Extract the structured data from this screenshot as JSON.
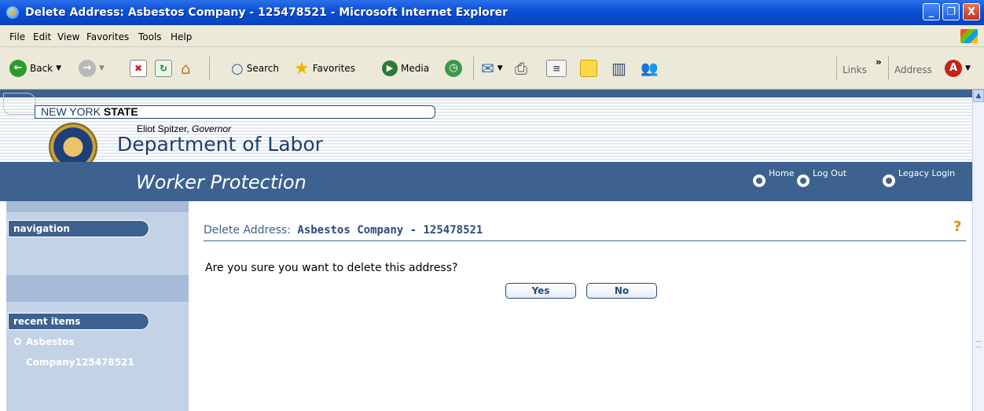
{
  "window": {
    "title": "Delete Address: Asbestos Company - 125478521 - Microsoft Internet Explorer",
    "minimize": "_",
    "restore": "❐",
    "close": "X"
  },
  "menu": [
    "File",
    "Edit",
    "View",
    "Favorites",
    "Tools",
    "Help"
  ],
  "toolbar": {
    "back": "Back",
    "search": "Search",
    "favorites": "Favorites",
    "media": "Media",
    "links": "Links",
    "chevron": "»",
    "address": "Address"
  },
  "header": {
    "new_york": "NEW YORK",
    "state": "STATE",
    "governor_name": "Eliot Spitzer,",
    "governor_title": "Governor",
    "department": "Department of Labor",
    "section": "Worker Protection",
    "links": {
      "home": "Home",
      "logout": "Log Out",
      "legacy": "Legacy Login"
    }
  },
  "sidebar": {
    "navigation": "navigation",
    "recent_items": "recent items",
    "recent": [
      "Asbestos",
      "Company125478521"
    ]
  },
  "content": {
    "title_label": "Delete Address:",
    "title_value": "Asbestos Company - 125478521",
    "message": "Are you sure you want to delete this address?",
    "yes": "Yes",
    "no": "No",
    "help": "?"
  },
  "colors": {
    "brand": "#3d628f",
    "sidebar": "#a7bbd9",
    "titlebar": "#0a4fd6"
  }
}
